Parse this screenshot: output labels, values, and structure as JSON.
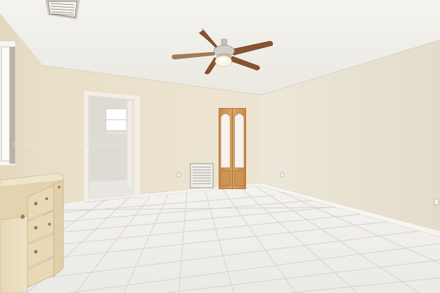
{
  "scene": {
    "watermark_text": "C 2024 REALTORS® Miami MLS 2025",
    "colors": {
      "ceiling": "#f1f0ec",
      "wall_back": "#ece4cf",
      "wall_right": "#e9e4d6",
      "wall_left": "#e6dcc4",
      "floor_tile": "#efeeea",
      "grout": "#d8d4cc",
      "baseboard": "#f5f3ee",
      "cabinet": "#eadbbd",
      "countertop": "#efe2c8",
      "door_wood": "#d49f5c",
      "fan_blade": "#8a5330",
      "fan_body": "#c9c6c0"
    }
  }
}
